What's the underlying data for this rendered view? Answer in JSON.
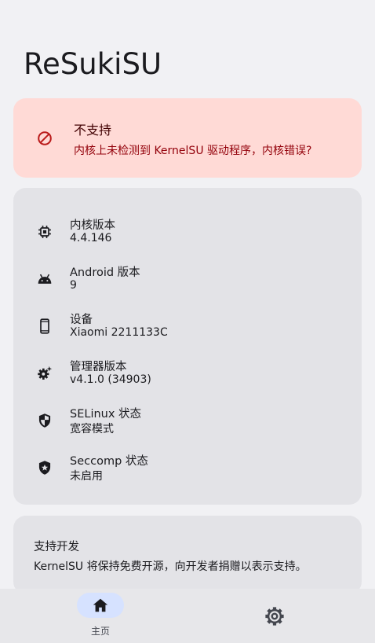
{
  "app": {
    "title": "ReSukiSU"
  },
  "status": {
    "title": "不支持",
    "description": "内核上未检测到 KernelSU 驱动程序，内核错误?",
    "icon": "block-icon",
    "bg_color": "#ffdad6",
    "text_color": "#93000a"
  },
  "info": {
    "items": [
      {
        "icon": "chip-icon",
        "label": "内核版本",
        "value": "4.4.146"
      },
      {
        "icon": "android-icon",
        "label": "Android 版本",
        "value": "9"
      },
      {
        "icon": "phone-icon",
        "label": "设备",
        "value": "Xiaomi 2211133C"
      },
      {
        "icon": "gear-sparkle-icon",
        "label": "管理器版本",
        "value": "v4.1.0 (34903)"
      },
      {
        "icon": "shield-half-icon",
        "label": "SELinux 状态",
        "value": "宽容模式"
      },
      {
        "icon": "shield-star-icon",
        "label": "Seccomp 状态",
        "value": "未启用"
      }
    ]
  },
  "support": {
    "title": "支持开发",
    "description": "KernelSU 将保持免费开源，向开发者捐赠以表示支持。"
  },
  "nav": {
    "home_label": "主页",
    "home_icon": "home-icon",
    "settings_icon": "settings-icon",
    "active_color": "#d6e2ff"
  }
}
